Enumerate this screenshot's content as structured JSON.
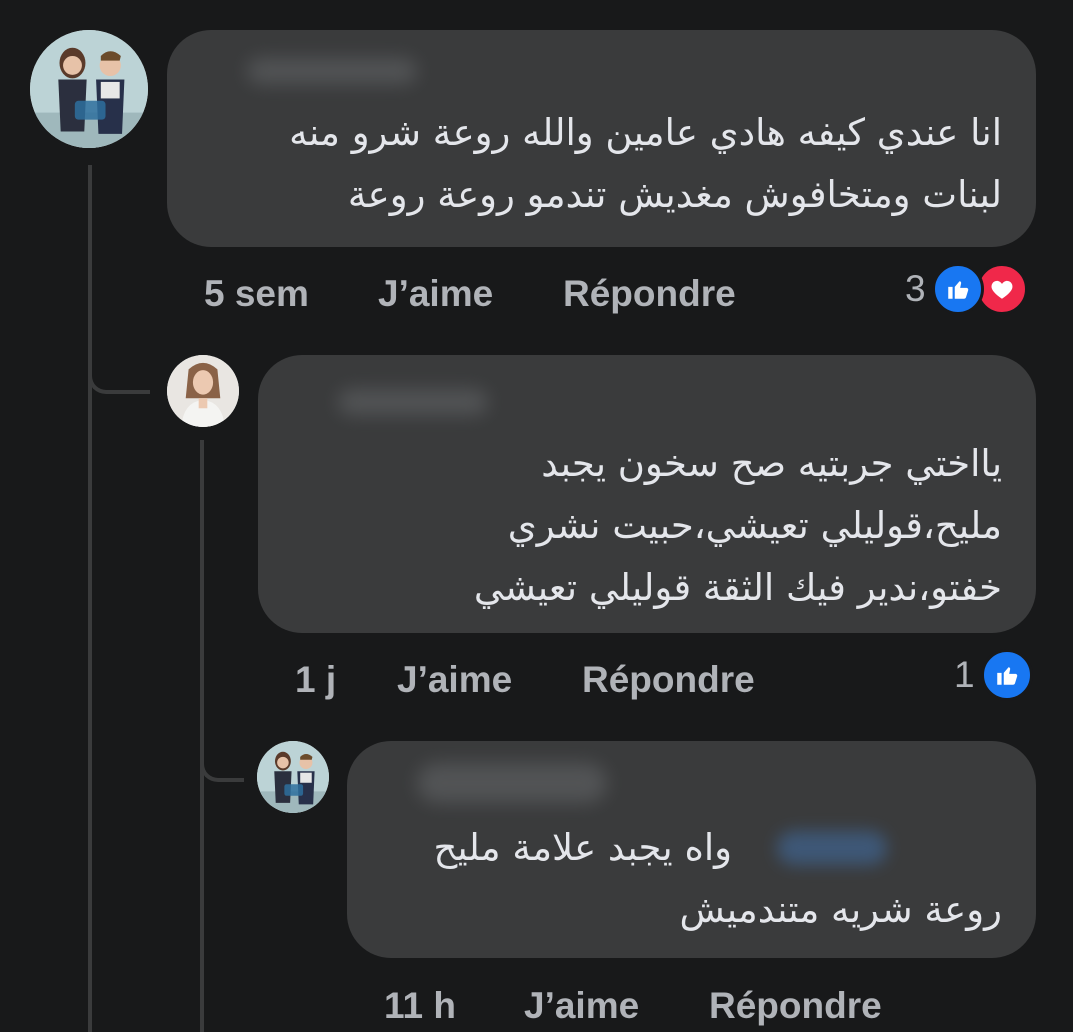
{
  "comments": [
    {
      "text_lines": [
        "انا عندي كيفه هادي عامين والله روعة شرو منه",
        "لبنات ومتخافوش مغديش تندمو روعة روعة"
      ],
      "time": "5 sem",
      "like_label": "J’aime",
      "reply_label": "Répondre",
      "reaction_count": "3",
      "reactions": [
        "like-icon",
        "love-icon"
      ]
    },
    {
      "text_lines": [
        "يااختي جربتيه صح سخون يجبد",
        "مليح،قوليلي تعيشي،حبيت نشري",
        "خفتو،ندير فيك الثقة قوليلي تعيشي"
      ],
      "time": "1 j",
      "like_label": "J’aime",
      "reply_label": "Répondre",
      "reaction_count": "1",
      "reactions": [
        "like-icon"
      ]
    },
    {
      "text_lines": [
        "واه يجبد علامة مليح",
        "روعة شريه متندميش"
      ],
      "time": "11 h",
      "like_label": "J’aime",
      "reply_label": "Répondre"
    }
  ],
  "colors": {
    "background": "#18191a",
    "bubble": "#3a3b3c",
    "text": "#e4e6eb",
    "meta_text": "#b0b3b8",
    "like_blue": "#1877f2",
    "love_red": "#f0284a"
  }
}
